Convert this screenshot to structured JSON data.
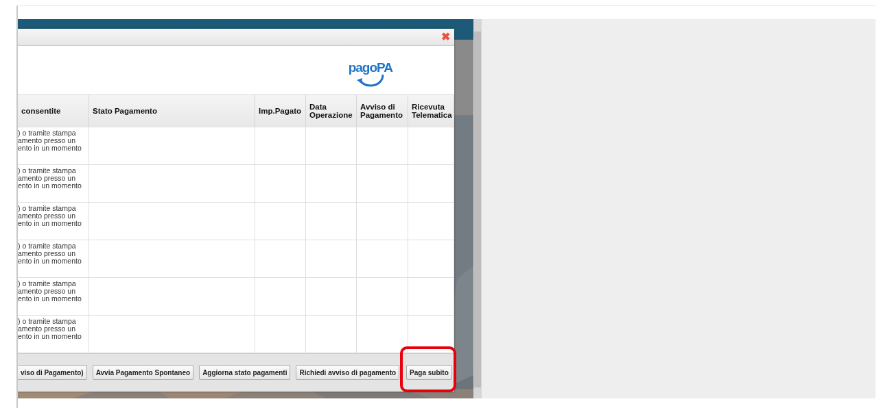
{
  "dialog": {
    "close": "✖",
    "logo": "pagoPA",
    "table": {
      "columns": [
        "consentite",
        "Stato Pagamento",
        "Imp.Pagato",
        "Data Operazione",
        "Avviso di Pagamento",
        "Ricevuta Telematica"
      ],
      "rows": [
        [
          ") o tramite stampa\namento presso un\nento in un momento",
          "",
          "",
          "",
          "",
          ""
        ],
        [
          ") o tramite stampa\namento presso un\nento in un momento",
          "",
          "",
          "",
          "",
          ""
        ],
        [
          ") o tramite stampa\namento presso un\nento in un momento",
          "",
          "",
          "",
          "",
          ""
        ],
        [
          ") o tramite stampa\namento presso un\nento in un momento",
          "",
          "",
          "",
          "",
          ""
        ],
        [
          ") o tramite stampa\namento presso un\nento in un momento",
          "",
          "",
          "",
          "",
          ""
        ],
        [
          ") o tramite stampa\namento presso un\nento in un momento",
          "",
          "",
          "",
          "",
          ""
        ]
      ]
    },
    "buttons": [
      {
        "label": "viso di Pagamento)",
        "highlighted": false
      },
      {
        "label": "Avvia Pagamento Spontaneo",
        "highlighted": false
      },
      {
        "label": "Aggiorna stato pagamenti",
        "highlighted": false
      },
      {
        "label": "Richiedi avviso di pagamento",
        "highlighted": false
      },
      {
        "label": "Paga subito",
        "highlighted": true
      }
    ]
  }
}
